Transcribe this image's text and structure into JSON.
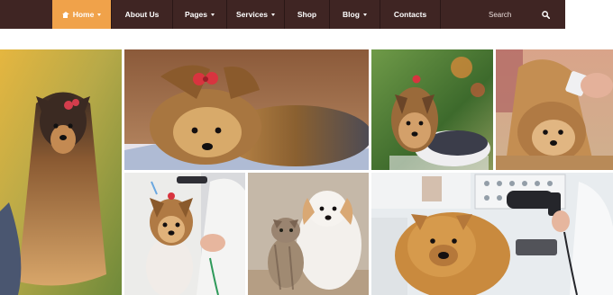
{
  "nav": {
    "items": [
      {
        "label": "Home",
        "has_caret": true,
        "active": true
      },
      {
        "label": "About Us",
        "has_caret": false,
        "active": false
      },
      {
        "label": "Pages",
        "has_caret": true,
        "active": false
      },
      {
        "label": "Services",
        "has_caret": true,
        "active": false
      },
      {
        "label": "Shop",
        "has_caret": false,
        "active": false
      },
      {
        "label": "Blog",
        "has_caret": true,
        "active": false
      },
      {
        "label": "Contacts",
        "has_caret": false,
        "active": false
      }
    ],
    "search_placeholder": "Search",
    "colors": {
      "bar": "#3f2523",
      "active": "#f0a24a",
      "text": "#ffffff"
    }
  },
  "gallery": {
    "tiles": [
      {
        "id": "yorkie-long-hair"
      },
      {
        "id": "yorkie-lying-bow"
      },
      {
        "id": "yorkie-grass"
      },
      {
        "id": "yorkie-grooming-brush"
      },
      {
        "id": "yorkie-haircut"
      },
      {
        "id": "kitten-and-puppy"
      },
      {
        "id": "chow-chow-blow-dry"
      }
    ]
  }
}
